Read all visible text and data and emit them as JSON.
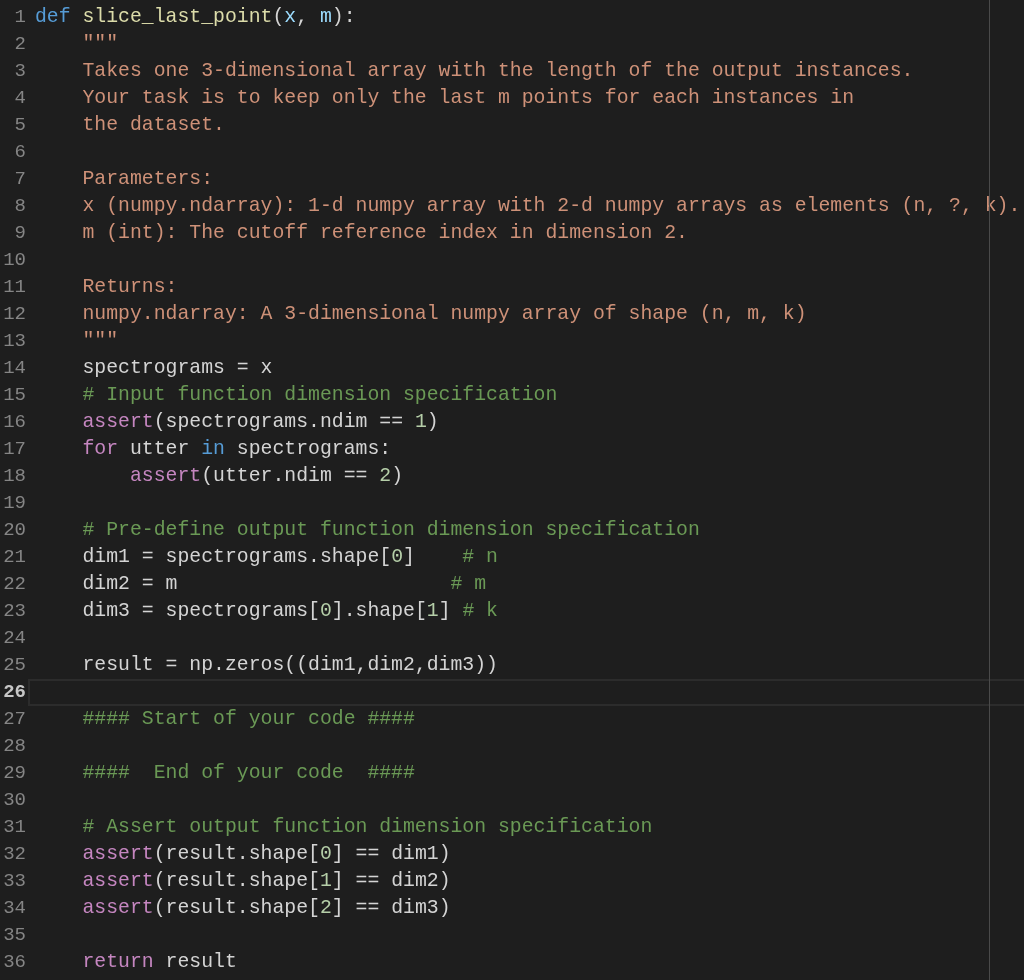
{
  "editor": {
    "lines": [
      {
        "number": "1",
        "current": false,
        "tokens": [
          {
            "kind": "keyword",
            "text": "def "
          },
          {
            "kind": "function",
            "text": "slice_last_point"
          },
          {
            "kind": "plain",
            "text": "("
          },
          {
            "kind": "param",
            "text": "x"
          },
          {
            "kind": "plain",
            "text": ", "
          },
          {
            "kind": "param",
            "text": "m"
          },
          {
            "kind": "plain",
            "text": "):"
          }
        ]
      },
      {
        "number": "2",
        "current": false,
        "tokens": [
          {
            "kind": "string",
            "text": "    \"\"\""
          }
        ]
      },
      {
        "number": "3",
        "current": false,
        "tokens": [
          {
            "kind": "string",
            "text": "    Takes one 3-dimensional array with the length of the output instances."
          }
        ]
      },
      {
        "number": "4",
        "current": false,
        "tokens": [
          {
            "kind": "string",
            "text": "    Your task is to keep only the last m points for each instances in"
          }
        ]
      },
      {
        "number": "5",
        "current": false,
        "tokens": [
          {
            "kind": "string",
            "text": "    the dataset."
          }
        ]
      },
      {
        "number": "6",
        "current": false
      },
      {
        "number": "7",
        "current": false,
        "tokens": [
          {
            "kind": "string",
            "text": "    Parameters:"
          }
        ]
      },
      {
        "number": "8",
        "current": false,
        "tokens": [
          {
            "kind": "string",
            "text": "    x (numpy.ndarray): 1-d numpy array with 2-d numpy arrays as elements (n, ?, k)."
          }
        ]
      },
      {
        "number": "9",
        "current": false,
        "tokens": [
          {
            "kind": "string",
            "text": "    m (int): The cutoff reference index in dimension 2."
          }
        ]
      },
      {
        "number": "10",
        "current": false
      },
      {
        "number": "11",
        "current": false,
        "tokens": [
          {
            "kind": "string",
            "text": "    Returns:"
          }
        ]
      },
      {
        "number": "12",
        "current": false,
        "tokens": [
          {
            "kind": "string",
            "text": "    numpy.ndarray: A 3-dimensional numpy array of shape (n, m, k)"
          }
        ]
      },
      {
        "number": "13",
        "current": false,
        "tokens": [
          {
            "kind": "string",
            "text": "    \"\"\""
          }
        ]
      },
      {
        "number": "14",
        "current": false,
        "tokens": [
          {
            "kind": "plain",
            "text": "    spectrograms = x"
          }
        ]
      },
      {
        "number": "15",
        "current": false,
        "tokens": [
          {
            "kind": "comment",
            "text": "    # Input function dimension specification"
          }
        ]
      },
      {
        "number": "16",
        "current": false,
        "tokens": [
          {
            "kind": "control",
            "text": "    assert"
          },
          {
            "kind": "plain",
            "text": "(spectrograms.ndim == "
          },
          {
            "kind": "number",
            "text": "1"
          },
          {
            "kind": "plain",
            "text": ")"
          }
        ]
      },
      {
        "number": "17",
        "current": false,
        "tokens": [
          {
            "kind": "control",
            "text": "    for"
          },
          {
            "kind": "plain",
            "text": " utter "
          },
          {
            "kind": "keyword",
            "text": "in"
          },
          {
            "kind": "plain",
            "text": " spectrograms:"
          }
        ]
      },
      {
        "number": "18",
        "current": false,
        "tokens": [
          {
            "kind": "control",
            "text": "        assert"
          },
          {
            "kind": "plain",
            "text": "(utter.ndim == "
          },
          {
            "kind": "number",
            "text": "2"
          },
          {
            "kind": "plain",
            "text": ")"
          }
        ]
      },
      {
        "number": "19",
        "current": false
      },
      {
        "number": "20",
        "current": false,
        "tokens": [
          {
            "kind": "comment",
            "text": "    # Pre-define output function dimension specification"
          }
        ]
      },
      {
        "number": "21",
        "current": false,
        "tokens": [
          {
            "kind": "plain",
            "text": "    dim1 = spectrograms.shape["
          },
          {
            "kind": "number",
            "text": "0"
          },
          {
            "kind": "plain",
            "text": "]    "
          },
          {
            "kind": "comment",
            "text": "# n"
          }
        ]
      },
      {
        "number": "22",
        "current": false,
        "tokens": [
          {
            "kind": "plain",
            "text": "    dim2 = m                       "
          },
          {
            "kind": "comment",
            "text": "# m"
          }
        ]
      },
      {
        "number": "23",
        "current": false,
        "tokens": [
          {
            "kind": "plain",
            "text": "    dim3 = spectrograms["
          },
          {
            "kind": "number",
            "text": "0"
          },
          {
            "kind": "plain",
            "text": "].shape["
          },
          {
            "kind": "number",
            "text": "1"
          },
          {
            "kind": "plain",
            "text": "] "
          },
          {
            "kind": "comment",
            "text": "# k"
          }
        ]
      },
      {
        "number": "24",
        "current": false
      },
      {
        "number": "25",
        "current": false,
        "tokens": [
          {
            "kind": "plain",
            "text": "    result = np.zeros((dim1,dim2,dim3))"
          }
        ]
      },
      {
        "number": "26",
        "current": true
      },
      {
        "number": "27",
        "current": false,
        "tokens": [
          {
            "kind": "comment",
            "text": "    #### Start of your code ####"
          }
        ]
      },
      {
        "number": "28",
        "current": false
      },
      {
        "number": "29",
        "current": false,
        "tokens": [
          {
            "kind": "comment",
            "text": "    ####  End of your code  ####"
          }
        ]
      },
      {
        "number": "30",
        "current": false
      },
      {
        "number": "31",
        "current": false,
        "tokens": [
          {
            "kind": "comment",
            "text": "    # Assert output function dimension specification"
          }
        ]
      },
      {
        "number": "32",
        "current": false,
        "tokens": [
          {
            "kind": "control",
            "text": "    assert"
          },
          {
            "kind": "plain",
            "text": "(result.shape["
          },
          {
            "kind": "number",
            "text": "0"
          },
          {
            "kind": "plain",
            "text": "] == dim1)"
          }
        ]
      },
      {
        "number": "33",
        "current": false,
        "tokens": [
          {
            "kind": "control",
            "text": "    assert"
          },
          {
            "kind": "plain",
            "text": "(result.shape["
          },
          {
            "kind": "number",
            "text": "1"
          },
          {
            "kind": "plain",
            "text": "] == dim2)"
          }
        ]
      },
      {
        "number": "34",
        "current": false,
        "tokens": [
          {
            "kind": "control",
            "text": "    assert"
          },
          {
            "kind": "plain",
            "text": "(result.shape["
          },
          {
            "kind": "number",
            "text": "2"
          },
          {
            "kind": "plain",
            "text": "] == dim3)"
          }
        ]
      },
      {
        "number": "35",
        "current": false
      },
      {
        "number": "36",
        "current": false,
        "tokens": [
          {
            "kind": "control",
            "text": "    return"
          },
          {
            "kind": "plain",
            "text": " result"
          }
        ]
      }
    ]
  }
}
